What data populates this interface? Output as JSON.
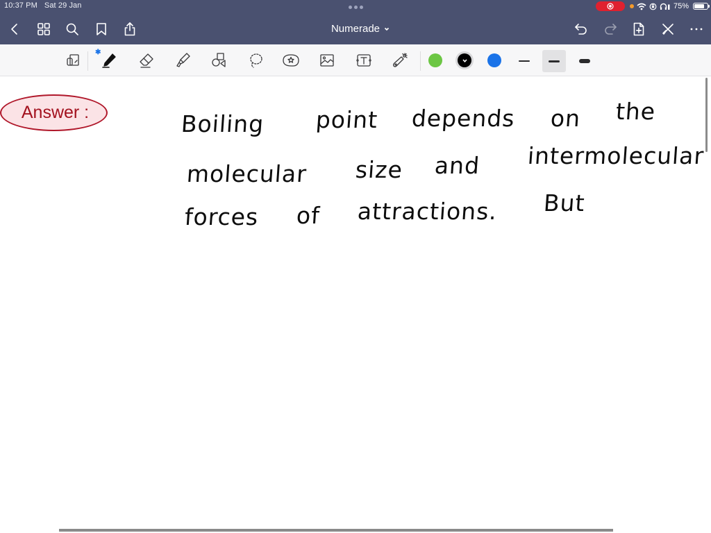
{
  "status_bar": {
    "time": "10:37 PM",
    "date": "Sat 29 Jan",
    "battery_percent": "75%",
    "battery_level": 0.75,
    "recording_color": "#e0212f"
  },
  "nav": {
    "title": "Numerade",
    "icons": {
      "back": "chevron-left-icon",
      "grid": "grid-icon",
      "search": "search-icon",
      "bookmark": "bookmark-icon",
      "share": "share-icon",
      "undo": "undo-icon",
      "redo": "redo-icon",
      "add_page": "add-page-icon",
      "close_pencil": "pencil-off-icon",
      "more": "more-icon"
    }
  },
  "toolbar": {
    "tools": [
      "read-mode",
      "pen",
      "eraser",
      "highlighter",
      "shapes",
      "lasso",
      "sticker",
      "image",
      "text",
      "laser-pointer"
    ],
    "bluetooth_mark": "✱",
    "colors": [
      {
        "name": "green",
        "hex": "#6cc644",
        "selected": false
      },
      {
        "name": "black",
        "hex": "#000000",
        "selected": true
      },
      {
        "name": "blue",
        "hex": "#1a73e8",
        "selected": false
      }
    ],
    "stroke_widths": [
      {
        "name": "thin",
        "selected": false
      },
      {
        "name": "medium",
        "selected": true
      },
      {
        "name": "thick",
        "selected": false
      }
    ]
  },
  "canvas": {
    "answer_label": "Answer :",
    "answer_colors": {
      "border": "#b0172a",
      "fill": "#fbe3e6",
      "text": "#a3121f"
    },
    "handwriting": {
      "line1": [
        "Boiling",
        "point",
        "depends",
        "on",
        "the"
      ],
      "line2": [
        "molecular",
        "size",
        "and",
        "intermolecular"
      ],
      "line3": [
        "forces",
        "of",
        "attractions.",
        "But"
      ]
    }
  }
}
